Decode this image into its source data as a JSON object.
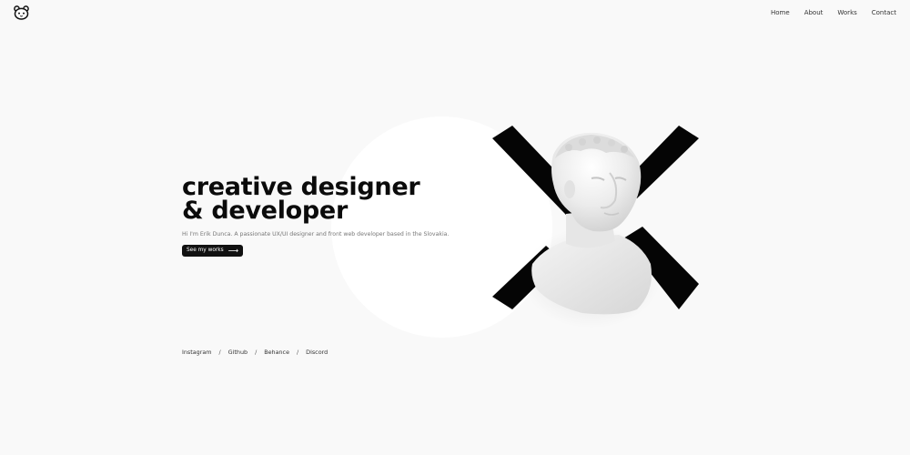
{
  "header": {
    "logo_icon": "panda-icon",
    "nav": [
      {
        "label": "Home"
      },
      {
        "label": "About"
      },
      {
        "label": "Works"
      },
      {
        "label": "Contact"
      }
    ]
  },
  "hero": {
    "headline_line1": "creative designer",
    "headline_line2": "& developer",
    "intro": "Hi I'm Erik Dunca. A passionate UX/UI designer and front web developer based in the Slovakia.",
    "cta_label": "See my works",
    "cta_icon": "arrow-right-icon",
    "art_icon": "statue-bust-icon"
  },
  "socials": {
    "items": [
      {
        "label": "Instagram"
      },
      {
        "label": "Github"
      },
      {
        "label": "Behance"
      },
      {
        "label": "Discord"
      }
    ],
    "separator": "/"
  },
  "colors": {
    "background": "#f9f9f9",
    "accent": "#111111",
    "circle": "#ffffff"
  }
}
